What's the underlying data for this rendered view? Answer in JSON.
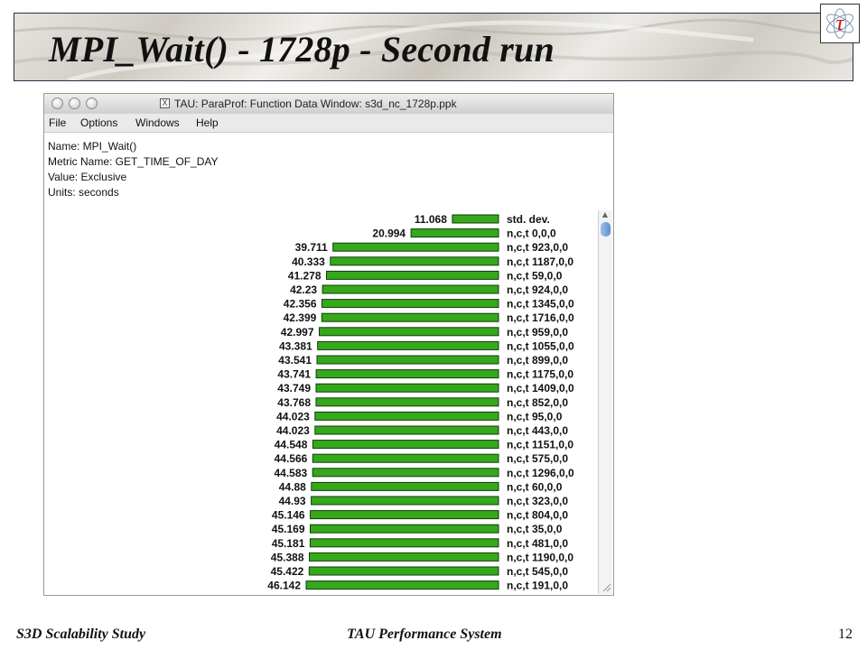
{
  "slide": {
    "title": "MPI_Wait() - 1728p - Second run",
    "footer_left": "S3D Scalability Study",
    "footer_center": "TAU Performance System",
    "page_number": "12",
    "logo_glyph": "τ"
  },
  "window": {
    "title": "TAU: ParaProf: Function Data Window: s3d_nc_1728p.ppk",
    "menu": [
      "File",
      "Options",
      "Windows",
      "Help"
    ],
    "info_lines": [
      "Name: MPI_Wait()",
      "Metric Name: GET_TIME_OF_DAY",
      "Value: Exclusive",
      "Units: seconds"
    ]
  },
  "colors": {
    "bar_fill": "#35a81c",
    "bar_border": "#0f3d0a",
    "logo_red": "#cc1111"
  },
  "chart_data": {
    "type": "bar",
    "orientation": "horizontal",
    "categories": [
      "std. dev.",
      "n,c,t 0,0,0",
      "n,c,t 923,0,0",
      "n,c,t 1187,0,0",
      "n,c,t 59,0,0",
      "n,c,t 924,0,0",
      "n,c,t 1345,0,0",
      "n,c,t 1716,0,0",
      "n,c,t 959,0,0",
      "n,c,t 1055,0,0",
      "n,c,t 899,0,0",
      "n,c,t 1175,0,0",
      "n,c,t 1409,0,0",
      "n,c,t 852,0,0",
      "n,c,t 95,0,0",
      "n,c,t 443,0,0",
      "n,c,t 1151,0,0",
      "n,c,t 575,0,0",
      "n,c,t 1296,0,0",
      "n,c,t 60,0,0",
      "n,c,t 323,0,0",
      "n,c,t 804,0,0",
      "n,c,t 35,0,0",
      "n,c,t 481,0,0",
      "n,c,t 1190,0,0",
      "n,c,t 545,0,0",
      "n,c,t 191,0,0"
    ],
    "value_labels": [
      "11.068",
      "20.994",
      "39.711",
      "40.333",
      "41.278",
      "42.23",
      "42.356",
      "42.399",
      "42.997",
      "43.381",
      "43.541",
      "43.741",
      "43.749",
      "43.768",
      "44.023",
      "44.023",
      "44.548",
      "44.566",
      "44.583",
      "44.88",
      "44.93",
      "45.146",
      "45.169",
      "45.181",
      "45.388",
      "45.422",
      "46.142"
    ],
    "values": [
      11.068,
      20.994,
      39.711,
      40.333,
      41.278,
      42.23,
      42.356,
      42.399,
      42.997,
      43.381,
      43.541,
      43.741,
      43.749,
      43.768,
      44.023,
      44.023,
      44.548,
      44.566,
      44.583,
      44.88,
      44.93,
      45.146,
      45.169,
      45.181,
      45.388,
      45.422,
      46.142
    ],
    "xlim": [
      0,
      46.142
    ],
    "grid": false,
    "legend": "none"
  }
}
